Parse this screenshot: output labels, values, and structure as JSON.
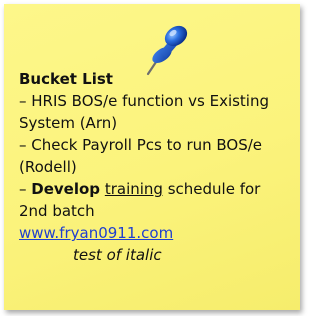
{
  "note": {
    "title": "Bucket List",
    "items": [
      {
        "lines": [
          "– HRIS BOS/e function vs Existing",
          "System (Arn)"
        ]
      },
      {
        "lines": [
          "– Check Payroll Pcs to run BOS/e",
          "(Rodell)"
        ]
      },
      {
        "prefix": "– ",
        "bold_word": "Develop",
        "space": " ",
        "underlined_word": "training",
        "rest": " schedule for",
        "line2": "2nd batch"
      }
    ],
    "link_text": "www.fryan0911.com",
    "italic_text": "test of italic"
  },
  "colors": {
    "note_background": "#fbf37c",
    "link": "#1f3fd0",
    "pin": "#1e5fd8"
  },
  "icons": {
    "pin": "pushpin-icon"
  }
}
